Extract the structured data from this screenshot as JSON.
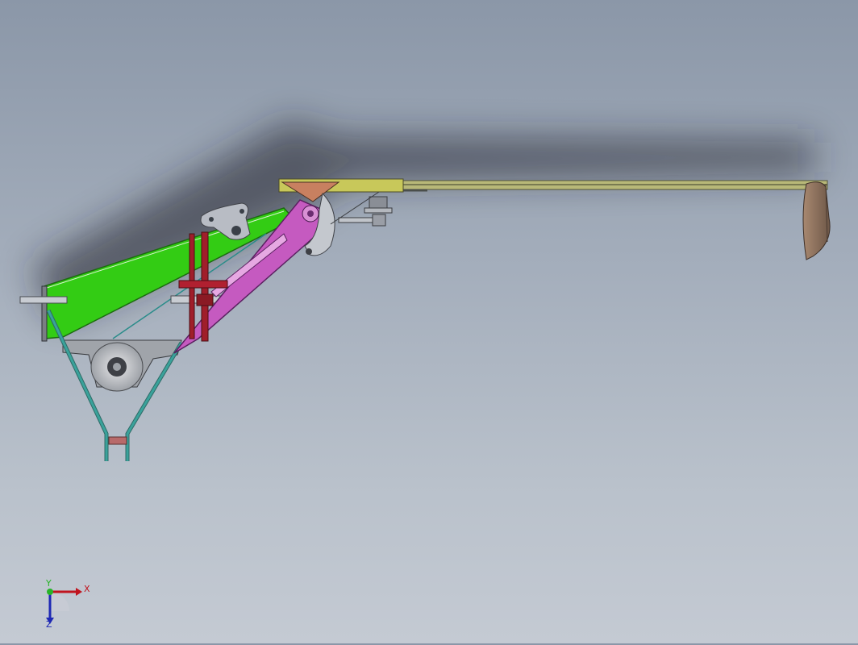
{
  "viewport": {
    "background_top": "#8b97a8",
    "background_bottom": "#c4cad3"
  },
  "model": {
    "parts": [
      {
        "name": "green-plate",
        "color": "#33cc14"
      },
      {
        "name": "magenta-arm",
        "color": "#c55ac0"
      },
      {
        "name": "triangle-frame",
        "color": "#3a9a93"
      },
      {
        "name": "yellow-rail",
        "color": "#c8c85a"
      },
      {
        "name": "brown-paddle",
        "color": "#8a7060"
      },
      {
        "name": "orange-wedge",
        "color": "#c88060"
      },
      {
        "name": "red-clamp",
        "color": "#a01e2a"
      },
      {
        "name": "grey-bracket",
        "color": "#9a9ea6"
      }
    ]
  },
  "triad": {
    "x_label": "X",
    "y_label": "Y",
    "z_label": "Z",
    "x_color": "#c0141e",
    "y_color": "#28b428",
    "z_color": "#1e28b4"
  }
}
